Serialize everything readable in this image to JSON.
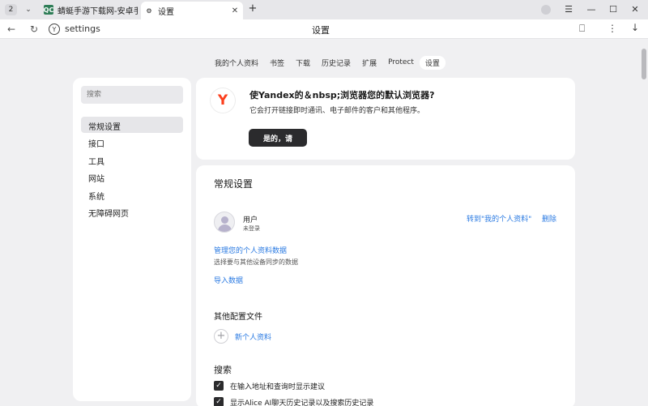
{
  "tabstrip": {
    "tab_count": "2",
    "tab_menu_icon": "chevron-down-icon",
    "tabs": [
      {
        "title": "蜻蜓手游下载网-安卓手游"
      },
      {
        "title": "设置"
      }
    ],
    "new_tab": "+",
    "window": {
      "menu": "☰",
      "minimize": "—",
      "maximize": "☐",
      "close": "✕"
    }
  },
  "addressbar": {
    "back": "←",
    "reload": "↻",
    "url": "settings",
    "page_title": "设置",
    "bookmark": "☐",
    "more": "⋮",
    "download": "↓"
  },
  "nav": {
    "tabs": [
      "我的个人资料",
      "书签",
      "下载",
      "历史记录",
      "扩展",
      "Protect",
      "设置"
    ],
    "active_index": 6
  },
  "sidebar": {
    "search_placeholder": "搜索",
    "items": [
      "常规设置",
      "接口",
      "工具",
      "网站",
      "系统",
      "无障碍网页"
    ],
    "active_index": 0
  },
  "default_browser": {
    "logo": "Y",
    "title": "使Yandex的＆nbsp;浏览器您的默认浏览器?",
    "description": "它会打开链接即时通讯、电子邮件的客户和其他程序。",
    "button": "是的，请"
  },
  "general": {
    "title": "常规设置",
    "user": {
      "name": "用户",
      "status": "未登录",
      "go_profile": "转到\"我的个人资料\"",
      "delete": "删除"
    },
    "manage_link": "管理您的个人资料数据",
    "manage_hint": "选择要与其他设备同步的数据",
    "import_link": "导入数据",
    "other_profiles_title": "其他配置文件",
    "new_profile": "新个人资料",
    "search_title": "搜索",
    "checkboxes": [
      {
        "label": "在输入地址和查询时显示建议",
        "checked": true
      },
      {
        "label": "显示Alice AI聊天历史记录以及搜索历史记录",
        "checked": true
      }
    ]
  }
}
